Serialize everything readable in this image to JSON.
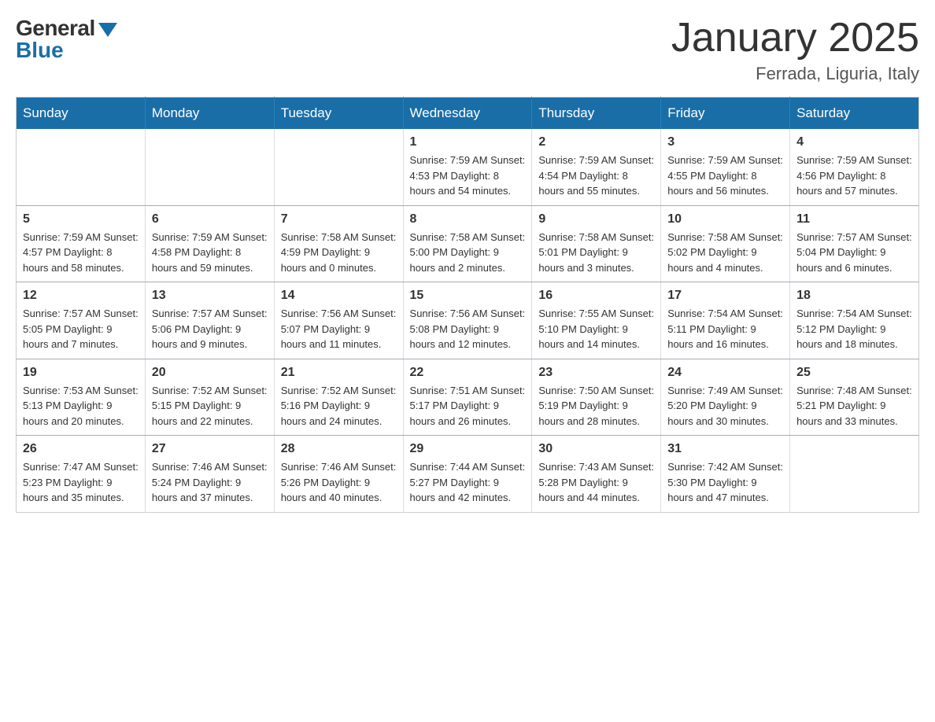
{
  "logo": {
    "general": "General",
    "blue": "Blue"
  },
  "header": {
    "title": "January 2025",
    "subtitle": "Ferrada, Liguria, Italy"
  },
  "weekdays": [
    "Sunday",
    "Monday",
    "Tuesday",
    "Wednesday",
    "Thursday",
    "Friday",
    "Saturday"
  ],
  "weeks": [
    [
      {
        "day": "",
        "info": ""
      },
      {
        "day": "",
        "info": ""
      },
      {
        "day": "",
        "info": ""
      },
      {
        "day": "1",
        "info": "Sunrise: 7:59 AM\nSunset: 4:53 PM\nDaylight: 8 hours\nand 54 minutes."
      },
      {
        "day": "2",
        "info": "Sunrise: 7:59 AM\nSunset: 4:54 PM\nDaylight: 8 hours\nand 55 minutes."
      },
      {
        "day": "3",
        "info": "Sunrise: 7:59 AM\nSunset: 4:55 PM\nDaylight: 8 hours\nand 56 minutes."
      },
      {
        "day": "4",
        "info": "Sunrise: 7:59 AM\nSunset: 4:56 PM\nDaylight: 8 hours\nand 57 minutes."
      }
    ],
    [
      {
        "day": "5",
        "info": "Sunrise: 7:59 AM\nSunset: 4:57 PM\nDaylight: 8 hours\nand 58 minutes."
      },
      {
        "day": "6",
        "info": "Sunrise: 7:59 AM\nSunset: 4:58 PM\nDaylight: 8 hours\nand 59 minutes."
      },
      {
        "day": "7",
        "info": "Sunrise: 7:58 AM\nSunset: 4:59 PM\nDaylight: 9 hours\nand 0 minutes."
      },
      {
        "day": "8",
        "info": "Sunrise: 7:58 AM\nSunset: 5:00 PM\nDaylight: 9 hours\nand 2 minutes."
      },
      {
        "day": "9",
        "info": "Sunrise: 7:58 AM\nSunset: 5:01 PM\nDaylight: 9 hours\nand 3 minutes."
      },
      {
        "day": "10",
        "info": "Sunrise: 7:58 AM\nSunset: 5:02 PM\nDaylight: 9 hours\nand 4 minutes."
      },
      {
        "day": "11",
        "info": "Sunrise: 7:57 AM\nSunset: 5:04 PM\nDaylight: 9 hours\nand 6 minutes."
      }
    ],
    [
      {
        "day": "12",
        "info": "Sunrise: 7:57 AM\nSunset: 5:05 PM\nDaylight: 9 hours\nand 7 minutes."
      },
      {
        "day": "13",
        "info": "Sunrise: 7:57 AM\nSunset: 5:06 PM\nDaylight: 9 hours\nand 9 minutes."
      },
      {
        "day": "14",
        "info": "Sunrise: 7:56 AM\nSunset: 5:07 PM\nDaylight: 9 hours\nand 11 minutes."
      },
      {
        "day": "15",
        "info": "Sunrise: 7:56 AM\nSunset: 5:08 PM\nDaylight: 9 hours\nand 12 minutes."
      },
      {
        "day": "16",
        "info": "Sunrise: 7:55 AM\nSunset: 5:10 PM\nDaylight: 9 hours\nand 14 minutes."
      },
      {
        "day": "17",
        "info": "Sunrise: 7:54 AM\nSunset: 5:11 PM\nDaylight: 9 hours\nand 16 minutes."
      },
      {
        "day": "18",
        "info": "Sunrise: 7:54 AM\nSunset: 5:12 PM\nDaylight: 9 hours\nand 18 minutes."
      }
    ],
    [
      {
        "day": "19",
        "info": "Sunrise: 7:53 AM\nSunset: 5:13 PM\nDaylight: 9 hours\nand 20 minutes."
      },
      {
        "day": "20",
        "info": "Sunrise: 7:52 AM\nSunset: 5:15 PM\nDaylight: 9 hours\nand 22 minutes."
      },
      {
        "day": "21",
        "info": "Sunrise: 7:52 AM\nSunset: 5:16 PM\nDaylight: 9 hours\nand 24 minutes."
      },
      {
        "day": "22",
        "info": "Sunrise: 7:51 AM\nSunset: 5:17 PM\nDaylight: 9 hours\nand 26 minutes."
      },
      {
        "day": "23",
        "info": "Sunrise: 7:50 AM\nSunset: 5:19 PM\nDaylight: 9 hours\nand 28 minutes."
      },
      {
        "day": "24",
        "info": "Sunrise: 7:49 AM\nSunset: 5:20 PM\nDaylight: 9 hours\nand 30 minutes."
      },
      {
        "day": "25",
        "info": "Sunrise: 7:48 AM\nSunset: 5:21 PM\nDaylight: 9 hours\nand 33 minutes."
      }
    ],
    [
      {
        "day": "26",
        "info": "Sunrise: 7:47 AM\nSunset: 5:23 PM\nDaylight: 9 hours\nand 35 minutes."
      },
      {
        "day": "27",
        "info": "Sunrise: 7:46 AM\nSunset: 5:24 PM\nDaylight: 9 hours\nand 37 minutes."
      },
      {
        "day": "28",
        "info": "Sunrise: 7:46 AM\nSunset: 5:26 PM\nDaylight: 9 hours\nand 40 minutes."
      },
      {
        "day": "29",
        "info": "Sunrise: 7:44 AM\nSunset: 5:27 PM\nDaylight: 9 hours\nand 42 minutes."
      },
      {
        "day": "30",
        "info": "Sunrise: 7:43 AM\nSunset: 5:28 PM\nDaylight: 9 hours\nand 44 minutes."
      },
      {
        "day": "31",
        "info": "Sunrise: 7:42 AM\nSunset: 5:30 PM\nDaylight: 9 hours\nand 47 minutes."
      },
      {
        "day": "",
        "info": ""
      }
    ]
  ]
}
